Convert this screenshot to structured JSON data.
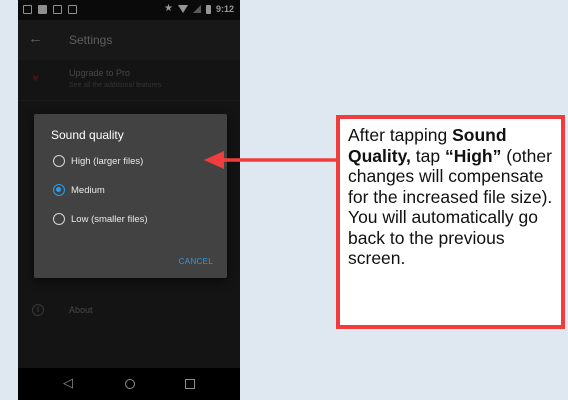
{
  "status_bar": {
    "time": "9:12",
    "icons": [
      "photo-icon",
      "media-icon",
      "cast-icon",
      "download-icon",
      "star-icon",
      "wifi-icon",
      "signal-icon",
      "battery-icon"
    ]
  },
  "app_bar": {
    "back_icon": "back-arrow-icon",
    "title": "Settings"
  },
  "settings": {
    "upgrade_title": "Upgrade to Pro",
    "upgrade_subtitle": "See all the additional features",
    "about_title": "About"
  },
  "dialog": {
    "title": "Sound quality",
    "options": [
      {
        "label": "High (larger files)",
        "selected": false
      },
      {
        "label": "Medium",
        "selected": true
      },
      {
        "label": "Low (smaller files)",
        "selected": false
      }
    ],
    "cancel_label": "CANCEL"
  },
  "nav_bar": {
    "icons": [
      "back-triangle-icon",
      "home-circle-icon",
      "recents-square-icon"
    ]
  },
  "annotation": {
    "text_1": "After tapping ",
    "bold_1": "Sound Quality,",
    "text_2": " tap ",
    "bold_2": "“High”",
    "text_3": " (other changes will compensate for the increased file size). You will automatically go back to the previous screen."
  },
  "colors": {
    "accent": "#2c9be7",
    "callout_border": "#f03c3c",
    "arrow": "#f03c3c",
    "background": "#dfe7f1"
  }
}
